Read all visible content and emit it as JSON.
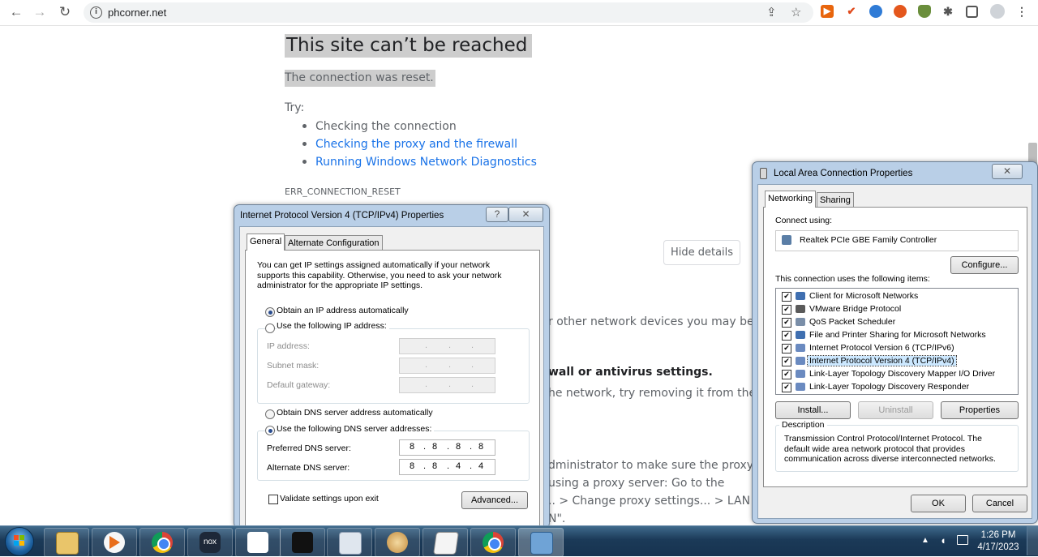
{
  "browser": {
    "url": "phcorner.net",
    "back_icon": "←",
    "forward_icon": "→",
    "reload_icon": "↻"
  },
  "error_page": {
    "title": "This site can’t be reached",
    "subtitle": "The connection was reset.",
    "try_label": "Try:",
    "suggestions": [
      "Checking the connection",
      "Checking the proxy and the firewall",
      "Running Windows Network Diagnostics"
    ],
    "error_code": "ERR_CONNECTION_RESET",
    "hide_details": "Hide details",
    "details_fragments": [
      "r other network devices you may be",
      "wall or antivirus settings.",
      "he network, try removing it from the",
      "dministrator to make sure the proxy",
      "using a proxy server: Go to the",
      ".. > Change proxy settings... > LAN",
      "N\"."
    ]
  },
  "ipv4_dialog": {
    "title": "Internet Protocol Version 4 (TCP/IPv4) Properties",
    "help_button": "?",
    "close_button": "✕",
    "tabs": [
      "General",
      "Alternate Configuration"
    ],
    "intro": "You can get IP settings assigned automatically if your network supports this capability. Otherwise, you need to ask your network administrator for the appropriate IP settings.",
    "obtain_ip_auto": "Obtain an IP address automatically",
    "use_following_ip": "Use the following IP address:",
    "ip_address_label": "IP address:",
    "subnet_mask_label": "Subnet mask:",
    "default_gateway_label": "Default gateway:",
    "obtain_dns_auto": "Obtain DNS server address automatically",
    "use_following_dns": "Use the following DNS server addresses:",
    "preferred_dns_label": "Preferred DNS server:",
    "preferred_dns": [
      "8",
      "8",
      "8",
      "8"
    ],
    "alternate_dns_label": "Alternate DNS server:",
    "alternate_dns": [
      "8",
      "8",
      "4",
      "4"
    ],
    "validate_label": "Validate settings upon exit",
    "advanced_button": "Advanced..."
  },
  "lan_dialog": {
    "title": "Local Area Connection Properties",
    "close_button": "✕",
    "tabs": [
      "Networking",
      "Sharing"
    ],
    "connect_using_label": "Connect using:",
    "adapter": "Realtek PCIe GBE Family Controller",
    "configure_button": "Configure...",
    "items_label": "This connection uses the following items:",
    "items": [
      "Client for Microsoft Networks",
      "VMware Bridge Protocol",
      "QoS Packet Scheduler",
      "File and Printer Sharing for Microsoft Networks",
      "Internet Protocol Version 6 (TCP/IPv6)",
      "Internet Protocol Version 4 (TCP/IPv4)",
      "Link-Layer Topology Discovery Mapper I/O Driver",
      "Link-Layer Topology Discovery Responder"
    ],
    "install_button": "Install...",
    "uninstall_button": "Uninstall",
    "properties_button": "Properties",
    "description_label": "Description",
    "description": "Transmission Control Protocol/Internet Protocol. The default wide area network protocol that provides communication across diverse interconnected networks.",
    "ok_button": "OK",
    "cancel_button": "Cancel"
  },
  "taskbar": {
    "time": "1:26 PM",
    "date": "4/17/2023"
  },
  "colors": {
    "link": "#1a73e8",
    "selected_item": "#cce8ff"
  }
}
